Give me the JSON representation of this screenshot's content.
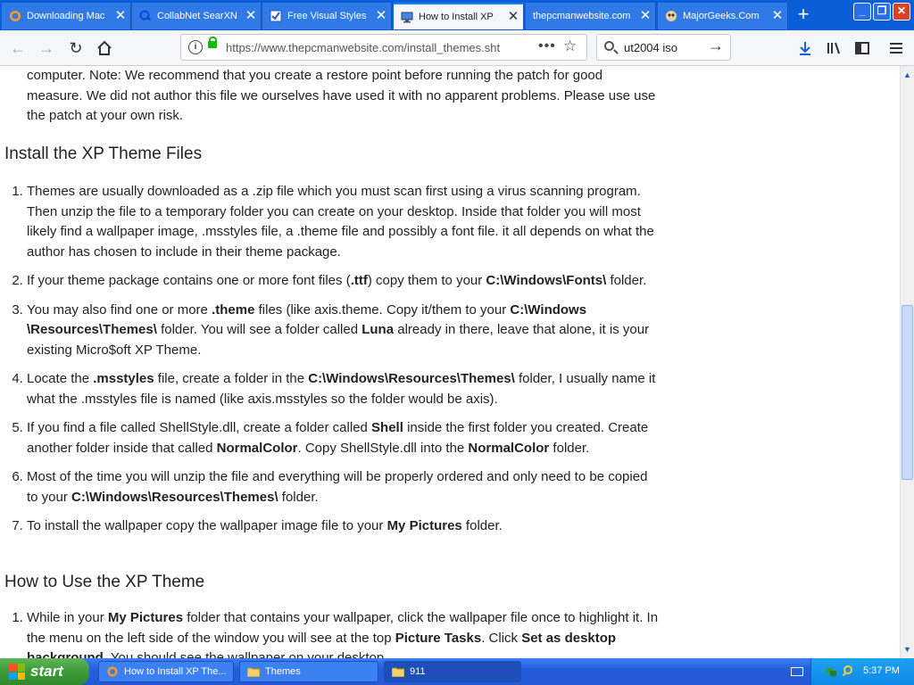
{
  "browser": {
    "tabs": [
      {
        "title": "Downloading Mac",
        "favicon": "firefox-icon"
      },
      {
        "title": "CollabNet SearXN",
        "favicon": "searx-icon"
      },
      {
        "title": "Free Visual Styles",
        "favicon": "visual-styles-icon"
      },
      {
        "title": "How to Install XP",
        "favicon": "monitor-icon",
        "active": true
      },
      {
        "title": "thepcmanwebsite.com",
        "favicon": "none"
      },
      {
        "title": "MajorGeeks.Com",
        "favicon": "majorgeeks-icon"
      }
    ],
    "new_tab_label": "+",
    "url": "https://www.thepcmanwebsite.com/install_themes.sht",
    "search_value": "ut2004 iso",
    "accent_color": "#0a84ff"
  },
  "article": {
    "intro_text": "computer. Note: We recommend that you create a restore point before running the patch for good measure. We did not author this file we ourselves have used it with no apparent problems. Please use use the patch at your own risk.",
    "heading_install": "Install the XP Theme Files",
    "install_steps": [
      {
        "parts": [
          {
            "t": "Themes are usually downloaded as a .zip file which you must scan first using a virus scanning program. Then unzip the file to a temporary folder you can create on your desktop. Inside that folder you will most likely find a wallpaper image, .msstyles file, a .theme file and possibly a font file. it all depends on what the author has chosen to include in their theme package."
          }
        ]
      },
      {
        "parts": [
          {
            "t": "If your theme package contains one or more font files ("
          },
          {
            "t": ".ttf",
            "b": true
          },
          {
            "t": ") copy them to your "
          },
          {
            "t": "C:\\Windows\\Fonts\\",
            "b": true
          },
          {
            "t": " folder."
          }
        ]
      },
      {
        "parts": [
          {
            "t": "You may also find one or more "
          },
          {
            "t": ".theme",
            "b": true
          },
          {
            "t": " files (like axis.theme. Copy it/them to your "
          },
          {
            "t": "C:\\Windows \\Resources\\Themes\\",
            "b": true
          },
          {
            "t": " folder. You will see a folder called "
          },
          {
            "t": "Luna",
            "b": true
          },
          {
            "t": " already in there, leave that alone, it is your existing Micro$oft XP Theme."
          }
        ]
      },
      {
        "parts": [
          {
            "t": "Locate the "
          },
          {
            "t": ".msstyles",
            "b": true
          },
          {
            "t": " file, create a folder in the "
          },
          {
            "t": "C:\\Windows\\Resources\\Themes\\",
            "b": true
          },
          {
            "t": " folder, I usually name it what the .msstyles file is named (like axis.msstyles so the folder would be axis)."
          }
        ]
      },
      {
        "parts": [
          {
            "t": "If you find a file called ShellStyle.dll, create a folder called "
          },
          {
            "t": "Shell",
            "b": true
          },
          {
            "t": " inside the first folder you created. Create another folder inside that called "
          },
          {
            "t": "NormalColor",
            "b": true
          },
          {
            "t": ". Copy ShellStyle.dll into the "
          },
          {
            "t": "NormalColor",
            "b": true
          },
          {
            "t": " folder."
          }
        ]
      },
      {
        "parts": [
          {
            "t": "Most of the time you will unzip the file and everything will be properly ordered and only need to be copied to your "
          },
          {
            "t": "C:\\Windows\\Resources\\Themes\\",
            "b": true
          },
          {
            "t": " folder."
          }
        ]
      },
      {
        "parts": [
          {
            "t": "To install the wallpaper copy the wallpaper image file to your "
          },
          {
            "t": "My Pictures",
            "b": true
          },
          {
            "t": " folder."
          }
        ]
      }
    ],
    "heading_use": "How to Use the XP Theme",
    "use_steps": [
      {
        "parts": [
          {
            "t": "While in your "
          },
          {
            "t": "My Pictures",
            "b": true
          },
          {
            "t": " folder that contains your wallpaper, click the wallpaper file once to highlight it. In the menu on the left side of the window you will see at the top "
          },
          {
            "t": "Picture Tasks",
            "b": true
          },
          {
            "t": ". Click "
          },
          {
            "t": "Set as desktop background",
            "b": true
          },
          {
            "t": ". You should see the wallpaper on your desktop."
          }
        ]
      }
    ]
  },
  "taskbar": {
    "start_label": "start",
    "buttons": [
      {
        "label": "How to Install XP The...",
        "icon": "firefox-icon"
      },
      {
        "label": "Themes",
        "icon": "folder-icon"
      },
      {
        "label": "911",
        "icon": "folder-icon",
        "active": true
      }
    ],
    "clock": "5:37 PM"
  }
}
